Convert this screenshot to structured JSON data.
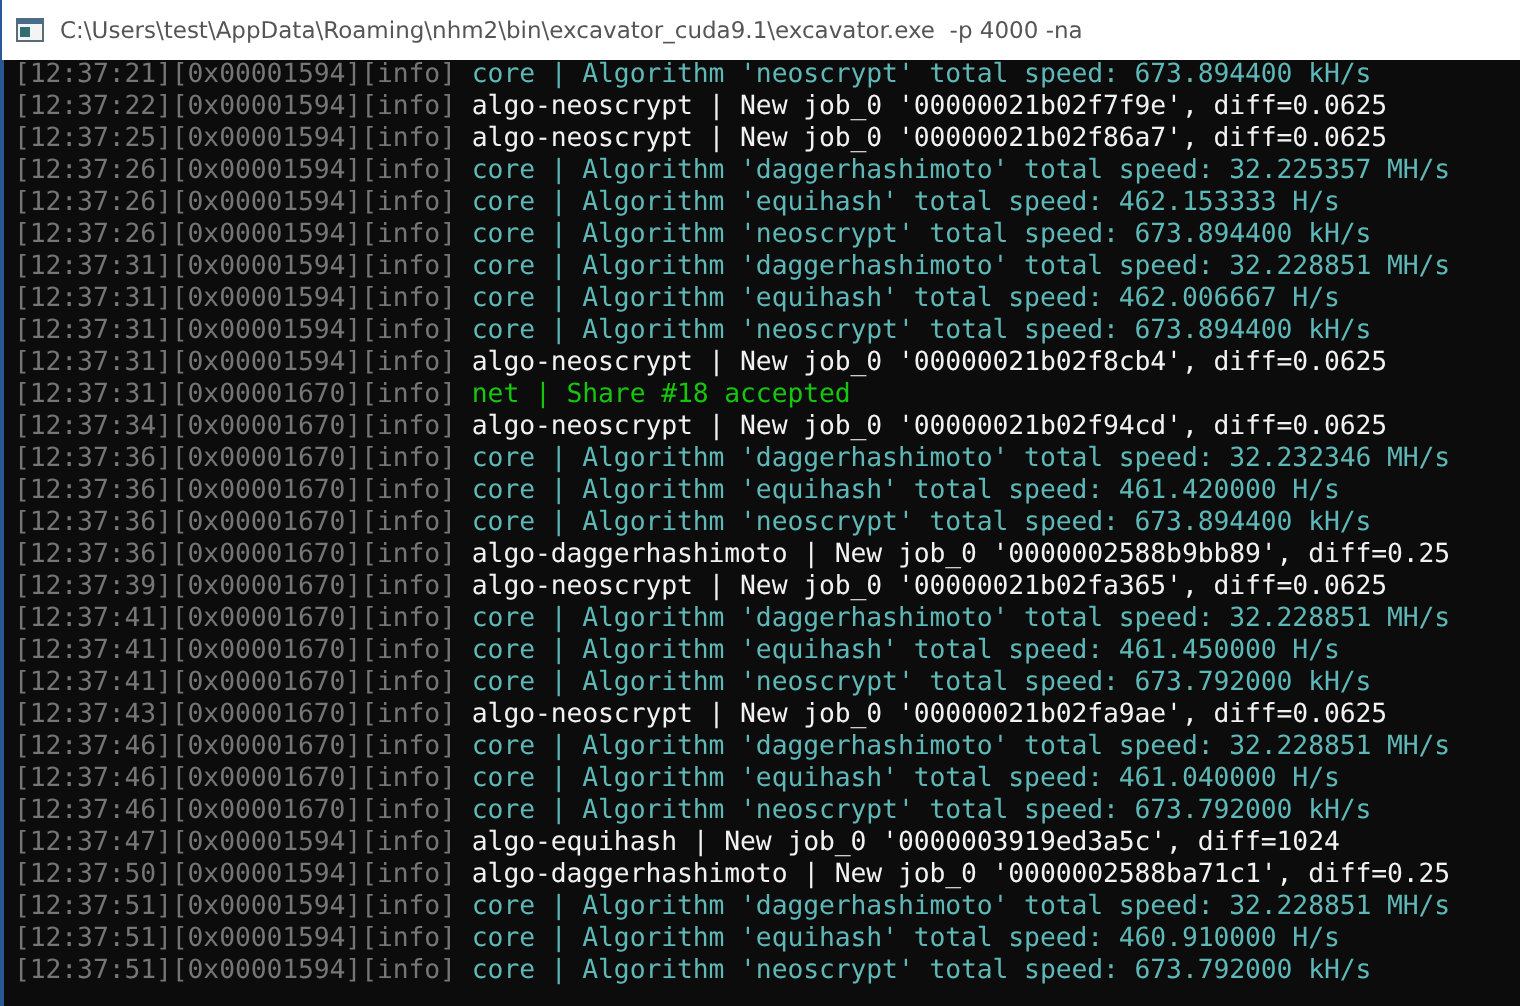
{
  "window": {
    "title": "C:\\Users\\test\\AppData\\Roaming\\nhm2\\bin\\excavator_cuda9.1\\excavator.exe  -p 4000 -na"
  },
  "lines": [
    {
      "prefix": "[12:37:21][0x00001594][info]",
      "kind": "core",
      "text": "core | Algorithm 'neoscrypt' total speed: 673.894400 kH/s"
    },
    {
      "prefix": "[12:37:22][0x00001594][info]",
      "kind": "algo",
      "text": "algo-neoscrypt | New job_0 '00000021b02f7f9e', diff=0.0625"
    },
    {
      "prefix": "[12:37:25][0x00001594][info]",
      "kind": "algo",
      "text": "algo-neoscrypt | New job_0 '00000021b02f86a7', diff=0.0625"
    },
    {
      "prefix": "[12:37:26][0x00001594][info]",
      "kind": "core",
      "text": "core | Algorithm 'daggerhashimoto' total speed: 32.225357 MH/s"
    },
    {
      "prefix": "[12:37:26][0x00001594][info]",
      "kind": "core",
      "text": "core | Algorithm 'equihash' total speed: 462.153333 H/s"
    },
    {
      "prefix": "[12:37:26][0x00001594][info]",
      "kind": "core",
      "text": "core | Algorithm 'neoscrypt' total speed: 673.894400 kH/s"
    },
    {
      "prefix": "[12:37:31][0x00001594][info]",
      "kind": "core",
      "text": "core | Algorithm 'daggerhashimoto' total speed: 32.228851 MH/s"
    },
    {
      "prefix": "[12:37:31][0x00001594][info]",
      "kind": "core",
      "text": "core | Algorithm 'equihash' total speed: 462.006667 H/s"
    },
    {
      "prefix": "[12:37:31][0x00001594][info]",
      "kind": "core",
      "text": "core | Algorithm 'neoscrypt' total speed: 673.894400 kH/s"
    },
    {
      "prefix": "[12:37:31][0x00001594][info]",
      "kind": "algo",
      "text": "algo-neoscrypt | New job_0 '00000021b02f8cb4', diff=0.0625"
    },
    {
      "prefix": "[12:37:31][0x00001670][info]",
      "kind": "net",
      "text": "net | Share #18 accepted"
    },
    {
      "prefix": "[12:37:34][0x00001670][info]",
      "kind": "algo",
      "text": "algo-neoscrypt | New job_0 '00000021b02f94cd', diff=0.0625"
    },
    {
      "prefix": "[12:37:36][0x00001670][info]",
      "kind": "core",
      "text": "core | Algorithm 'daggerhashimoto' total speed: 32.232346 MH/s"
    },
    {
      "prefix": "[12:37:36][0x00001670][info]",
      "kind": "core",
      "text": "core | Algorithm 'equihash' total speed: 461.420000 H/s"
    },
    {
      "prefix": "[12:37:36][0x00001670][info]",
      "kind": "core",
      "text": "core | Algorithm 'neoscrypt' total speed: 673.894400 kH/s"
    },
    {
      "prefix": "[12:37:36][0x00001670][info]",
      "kind": "algo",
      "text": "algo-daggerhashimoto | New job_0 '0000002588b9bb89', diff=0.25"
    },
    {
      "prefix": "[12:37:39][0x00001670][info]",
      "kind": "algo",
      "text": "algo-neoscrypt | New job_0 '00000021b02fa365', diff=0.0625"
    },
    {
      "prefix": "[12:37:41][0x00001670][info]",
      "kind": "core",
      "text": "core | Algorithm 'daggerhashimoto' total speed: 32.228851 MH/s"
    },
    {
      "prefix": "[12:37:41][0x00001670][info]",
      "kind": "core",
      "text": "core | Algorithm 'equihash' total speed: 461.450000 H/s"
    },
    {
      "prefix": "[12:37:41][0x00001670][info]",
      "kind": "core",
      "text": "core | Algorithm 'neoscrypt' total speed: 673.792000 kH/s"
    },
    {
      "prefix": "[12:37:43][0x00001670][info]",
      "kind": "algo",
      "text": "algo-neoscrypt | New job_0 '00000021b02fa9ae', diff=0.0625"
    },
    {
      "prefix": "[12:37:46][0x00001670][info]",
      "kind": "core",
      "text": "core | Algorithm 'daggerhashimoto' total speed: 32.228851 MH/s"
    },
    {
      "prefix": "[12:37:46][0x00001670][info]",
      "kind": "core",
      "text": "core | Algorithm 'equihash' total speed: 461.040000 H/s"
    },
    {
      "prefix": "[12:37:46][0x00001670][info]",
      "kind": "core",
      "text": "core | Algorithm 'neoscrypt' total speed: 673.792000 kH/s"
    },
    {
      "prefix": "[12:37:47][0x00001594][info]",
      "kind": "algo",
      "text": "algo-equihash | New job_0 '0000003919ed3a5c', diff=1024"
    },
    {
      "prefix": "[12:37:50][0x00001594][info]",
      "kind": "algo",
      "text": "algo-daggerhashimoto | New job_0 '0000002588ba71c1', diff=0.25"
    },
    {
      "prefix": "[12:37:51][0x00001594][info]",
      "kind": "core",
      "text": "core | Algorithm 'daggerhashimoto' total speed: 32.228851 MH/s"
    },
    {
      "prefix": "[12:37:51][0x00001594][info]",
      "kind": "core",
      "text": "core | Algorithm 'equihash' total speed: 460.910000 H/s"
    },
    {
      "prefix": "[12:37:51][0x00001594][info]",
      "kind": "core",
      "text": "core | Algorithm 'neoscrypt' total speed: 673.792000 kH/s"
    }
  ]
}
